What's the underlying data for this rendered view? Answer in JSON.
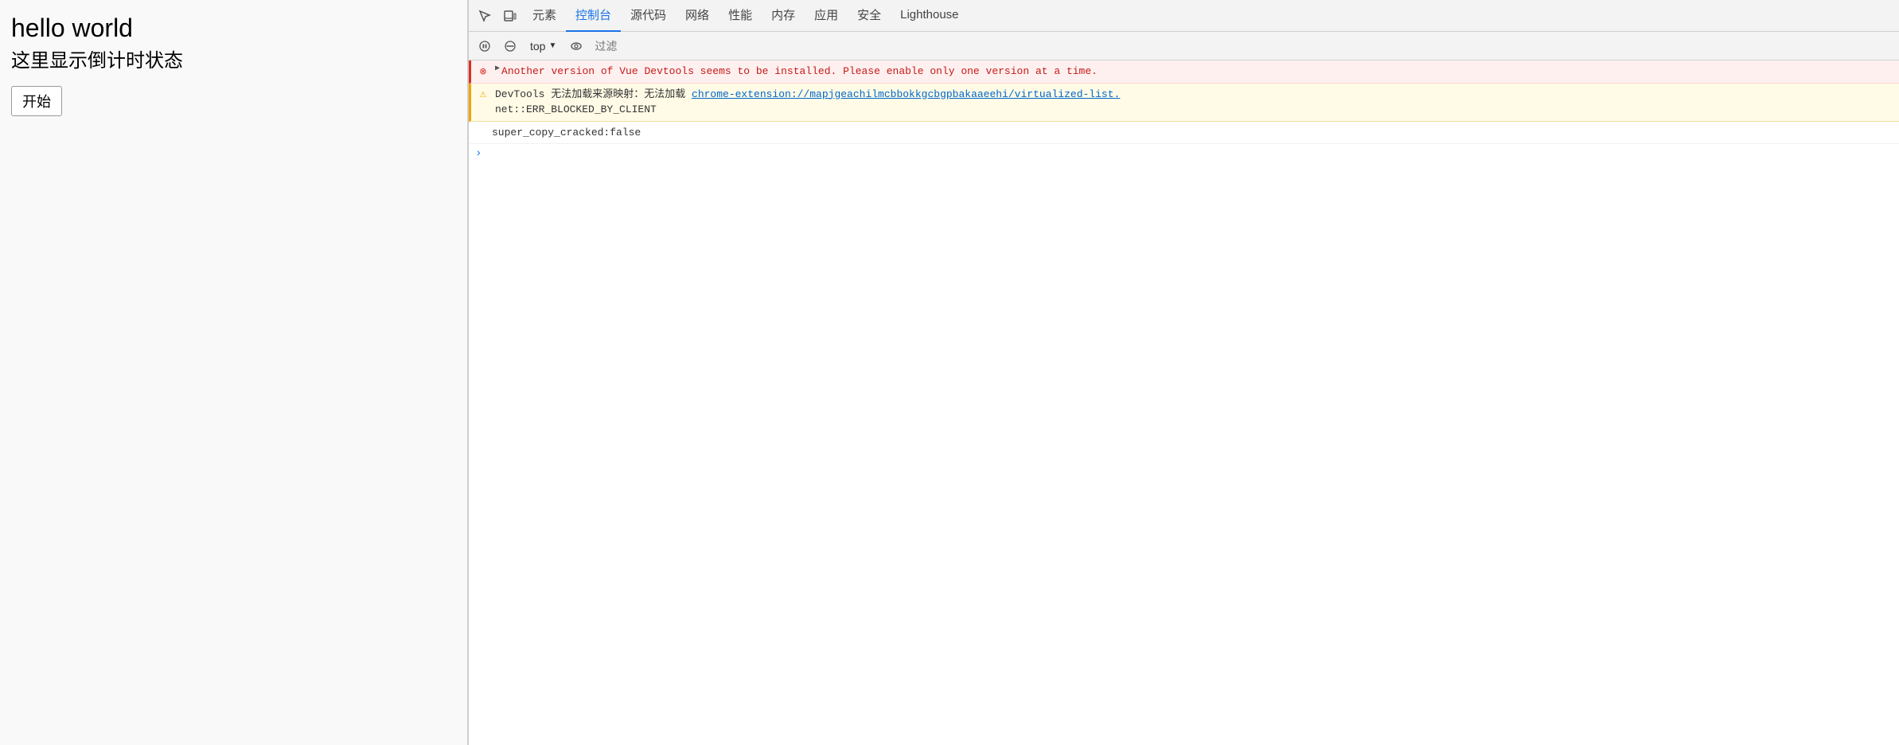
{
  "left": {
    "title": "hello world",
    "subtitle": "这里显示倒计时状态",
    "start_button": "开始"
  },
  "devtools": {
    "tabs": [
      {
        "label": "元素",
        "id": "elements"
      },
      {
        "label": "控制台",
        "id": "console",
        "active": true
      },
      {
        "label": "源代码",
        "id": "sources"
      },
      {
        "label": "网络",
        "id": "network"
      },
      {
        "label": "性能",
        "id": "performance"
      },
      {
        "label": "内存",
        "id": "memory"
      },
      {
        "label": "应用",
        "id": "application"
      },
      {
        "label": "安全",
        "id": "security"
      },
      {
        "label": "Lighthouse",
        "id": "lighthouse"
      }
    ],
    "toolbar": {
      "top_label": "top",
      "filter_placeholder": "过滤"
    },
    "console_messages": [
      {
        "type": "error",
        "text": "Another version of Vue Devtools seems to be installed. Please enable only one version at a time.",
        "has_expand": true
      },
      {
        "type": "warning",
        "text_before": "DevTools 无法加载来源映射：无法加载 ",
        "link": "chrome-extension://mapjgeachilmcbbokkgcbgpbakaaeehi/virtualized-list.",
        "text_after": "net::ERR_BLOCKED_BY_CLIENT"
      },
      {
        "type": "normal",
        "text": "super_copy_cracked:false"
      }
    ]
  }
}
